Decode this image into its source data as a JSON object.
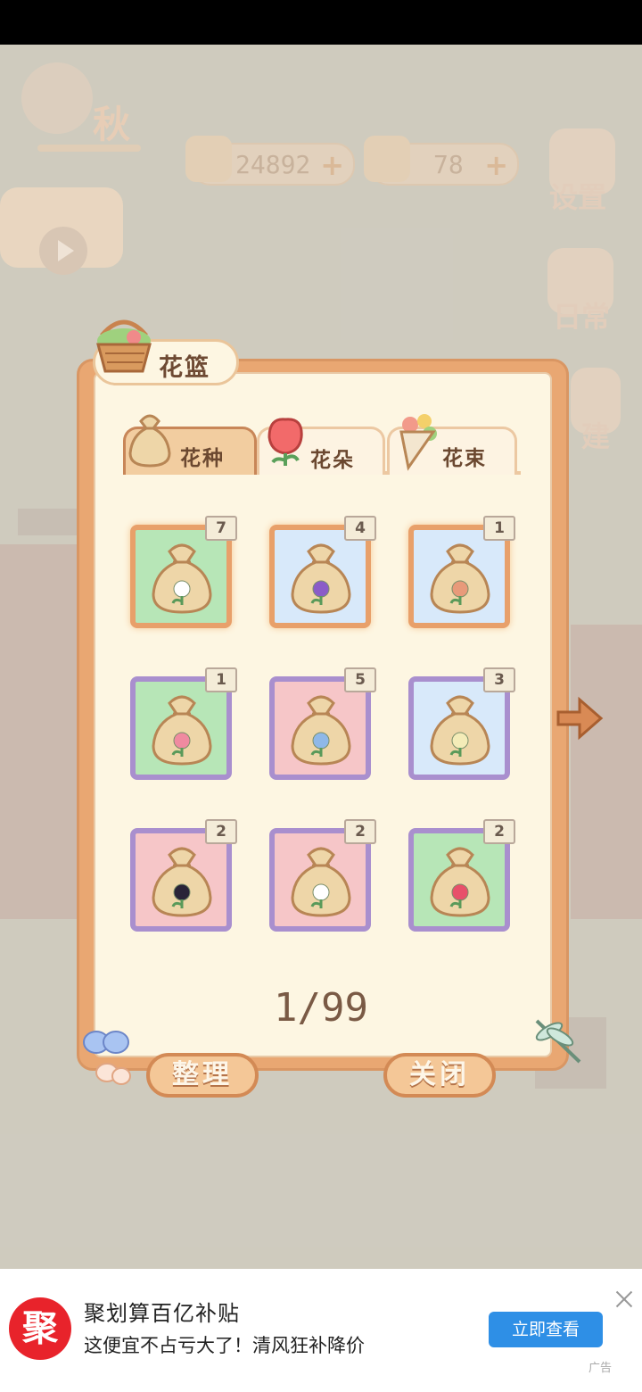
{
  "hud": {
    "season": "秋",
    "fish_count": "24892",
    "cheese_count": "78",
    "settings_label": "设置",
    "daily_label": "日常",
    "build_label": "建"
  },
  "dialog": {
    "title": "花篮",
    "tabs": [
      {
        "label": "花种",
        "icon": "seed-bag-icon",
        "active": true
      },
      {
        "label": "花朵",
        "icon": "rose-icon",
        "active": false
      },
      {
        "label": "花束",
        "icon": "bouquet-icon",
        "active": false
      }
    ],
    "slots": [
      {
        "count": "7",
        "frame": "orange",
        "bg": "green",
        "flower": "#ffffff"
      },
      {
        "count": "4",
        "frame": "orange",
        "bg": "blue",
        "flower": "#8a5cc8"
      },
      {
        "count": "1",
        "frame": "orange",
        "bg": "blue",
        "flower": "#e89a7a"
      },
      {
        "count": "1",
        "frame": "purple",
        "bg": "green",
        "flower": "#f08aa0"
      },
      {
        "count": "5",
        "frame": "purple",
        "bg": "pink",
        "flower": "#8fb8e8"
      },
      {
        "count": "3",
        "frame": "purple",
        "bg": "blue",
        "flower": "#f4ecb8"
      },
      {
        "count": "2",
        "frame": "purple",
        "bg": "pink",
        "flower": "#2a2438"
      },
      {
        "count": "2",
        "frame": "purple",
        "bg": "pink",
        "flower": "#ffffff"
      },
      {
        "count": "2",
        "frame": "purple",
        "bg": "green",
        "flower": "#e8506a"
      }
    ],
    "page_indicator": "1/99",
    "sort_button": "整理",
    "close_button": "关闭"
  },
  "ad": {
    "logo_text": "聚",
    "title": "聚划算百亿补贴",
    "description": "这便宜不占亏大了！清风狂补降价",
    "cta": "立即查看",
    "tag": "广告"
  },
  "colors": {
    "accent": "#e9a772",
    "title_text": "#6e4a33",
    "ad_cta": "#2e8fe6"
  }
}
